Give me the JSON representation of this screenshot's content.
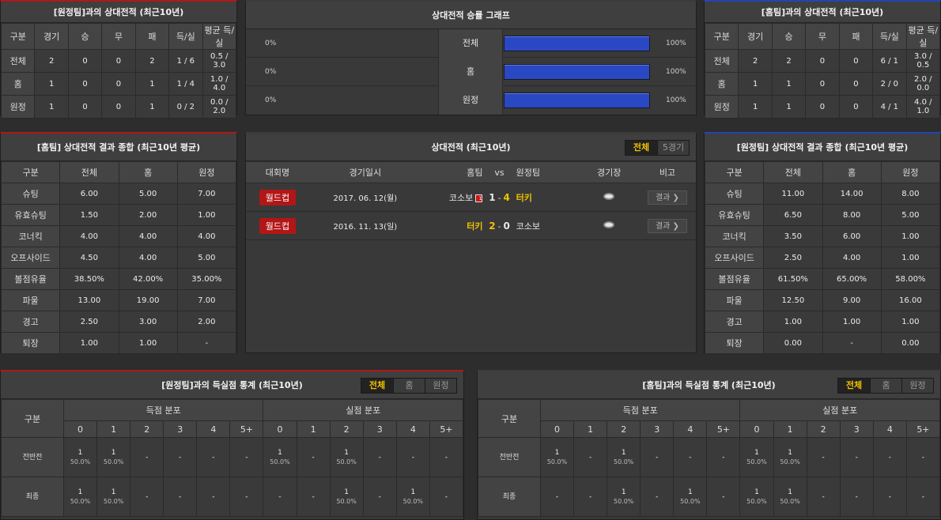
{
  "away_h2h": {
    "title": "[원정팀]과의 상대전적 (최근10년)",
    "headers": [
      "구분",
      "경기",
      "승",
      "무",
      "패",
      "득/실",
      "평균 득/실"
    ],
    "rows": [
      [
        "전체",
        "2",
        "0",
        "0",
        "2",
        "1 / 6",
        "0.5 / 3.0"
      ],
      [
        "홈",
        "1",
        "0",
        "0",
        "1",
        "1 / 4",
        "1.0 / 4.0"
      ],
      [
        "원정",
        "1",
        "0",
        "0",
        "1",
        "0 / 2",
        "0.0 / 2.0"
      ]
    ]
  },
  "graph": {
    "title": "상대전적 승률 그래프",
    "rows": [
      {
        "left": "0%",
        "label": "전체",
        "right": "100%",
        "value": 100
      },
      {
        "left": "0%",
        "label": "홈",
        "right": "100%",
        "value": 100
      },
      {
        "left": "0%",
        "label": "원정",
        "right": "100%",
        "value": 100
      }
    ]
  },
  "home_h2h": {
    "title": "[홈팀]과의 상대전적 (최근10년)",
    "headers": [
      "구분",
      "경기",
      "승",
      "무",
      "패",
      "득/실",
      "평균 득/실"
    ],
    "rows": [
      [
        "전체",
        "2",
        "2",
        "0",
        "0",
        "6 / 1",
        "3.0 / 0.5"
      ],
      [
        "홈",
        "1",
        "1",
        "0",
        "0",
        "2 / 0",
        "2.0 / 0.0"
      ],
      [
        "원정",
        "1",
        "1",
        "0",
        "0",
        "4 / 1",
        "4.0 / 1.0"
      ]
    ]
  },
  "home_summary": {
    "title": "[홈팀] 상대전적 결과 종합 (최근10년 평균)",
    "headers": [
      "구분",
      "전체",
      "홈",
      "원정"
    ],
    "rows": [
      [
        "슈팅",
        "6.00",
        "5.00",
        "7.00"
      ],
      [
        "유효슈팅",
        "1.50",
        "2.00",
        "1.00"
      ],
      [
        "코너킥",
        "4.00",
        "4.00",
        "4.00"
      ],
      [
        "오프사이드",
        "4.50",
        "4.00",
        "5.00"
      ],
      [
        "볼점유율",
        "38.50%",
        "42.00%",
        "35.00%"
      ],
      [
        "파울",
        "13.00",
        "19.00",
        "7.00"
      ],
      [
        "경고",
        "2.50",
        "3.00",
        "2.00"
      ],
      [
        "퇴장",
        "1.00",
        "1.00",
        "-"
      ]
    ]
  },
  "matches": {
    "title": "상대전적 (최근10년)",
    "toggle": [
      "전체",
      "5경기"
    ],
    "headers": {
      "league": "대회명",
      "date": "경기일시",
      "home": "홈팀",
      "vs": "vs",
      "away": "원정팀",
      "stadium": "경기장",
      "note": "비고"
    },
    "rows": [
      {
        "league": "월드컵",
        "date": "2017. 06. 12(월)",
        "home": "코소보",
        "card": "1",
        "home_score": "1",
        "dash": "-",
        "away_score": "4",
        "away": "터키",
        "result": "결과 ❯"
      },
      {
        "league": "월드컵",
        "date": "2016. 11. 13(일)",
        "home": "터키",
        "card": "",
        "home_score": "2",
        "dash": "-",
        "away_score": "0",
        "away": "코소보",
        "result": "결과 ❯"
      }
    ]
  },
  "away_summary": {
    "title": "[원정팀] 상대전적 결과 종합 (최근10년 평균)",
    "headers": [
      "구분",
      "전체",
      "홈",
      "원정"
    ],
    "rows": [
      [
        "슈팅",
        "11.00",
        "14.00",
        "8.00"
      ],
      [
        "유효슈팅",
        "6.50",
        "8.00",
        "5.00"
      ],
      [
        "코너킥",
        "3.50",
        "6.00",
        "1.00"
      ],
      [
        "오프사이드",
        "2.50",
        "4.00",
        "1.00"
      ],
      [
        "볼점유율",
        "61.50%",
        "65.00%",
        "58.00%"
      ],
      [
        "파울",
        "12.50",
        "9.00",
        "16.00"
      ],
      [
        "경고",
        "1.00",
        "1.00",
        "1.00"
      ],
      [
        "퇴장",
        "0.00",
        "-",
        "0.00"
      ]
    ]
  },
  "left_dist": {
    "title": "[원정팀]과의 득실점 통계 (최근10년)",
    "toggle": [
      "전체",
      "홈",
      "원정"
    ],
    "col_label": "구분",
    "score_label": "득점 분포",
    "concede_label": "실점 분포",
    "buckets": [
      "0",
      "1",
      "2",
      "3",
      "4",
      "5+"
    ],
    "rows": [
      {
        "label": "전반전",
        "cells": [
          [
            "1",
            "50.0%"
          ],
          [
            "1",
            "50.0%"
          ],
          [
            "-",
            ""
          ],
          [
            "-",
            ""
          ],
          [
            "-",
            ""
          ],
          [
            "-",
            ""
          ],
          [
            "1",
            "50.0%"
          ],
          [
            "-",
            ""
          ],
          [
            "1",
            "50.0%"
          ],
          [
            "-",
            ""
          ],
          [
            "-",
            ""
          ],
          [
            "-",
            ""
          ]
        ]
      },
      {
        "label": "최종",
        "cells": [
          [
            "1",
            "50.0%"
          ],
          [
            "1",
            "50.0%"
          ],
          [
            "-",
            ""
          ],
          [
            "-",
            ""
          ],
          [
            "-",
            ""
          ],
          [
            "-",
            ""
          ],
          [
            "-",
            ""
          ],
          [
            "-",
            ""
          ],
          [
            "1",
            "50.0%"
          ],
          [
            "-",
            ""
          ],
          [
            "1",
            "50.0%"
          ],
          [
            "-",
            ""
          ]
        ]
      }
    ]
  },
  "right_dist": {
    "title": "[홈팀]과의 득실점 통계 (최근10년)",
    "toggle": [
      "전체",
      "홈",
      "원정"
    ],
    "col_label": "구분",
    "score_label": "득점 분포",
    "concede_label": "실점 분포",
    "buckets": [
      "0",
      "1",
      "2",
      "3",
      "4",
      "5+"
    ],
    "rows": [
      {
        "label": "전반전",
        "cells": [
          [
            "1",
            "50.0%"
          ],
          [
            "-",
            ""
          ],
          [
            "1",
            "50.0%"
          ],
          [
            "-",
            ""
          ],
          [
            "-",
            ""
          ],
          [
            "-",
            ""
          ],
          [
            "1",
            "50.0%"
          ],
          [
            "1",
            "50.0%"
          ],
          [
            "-",
            ""
          ],
          [
            "-",
            ""
          ],
          [
            "-",
            ""
          ],
          [
            "-",
            ""
          ]
        ]
      },
      {
        "label": "최종",
        "cells": [
          [
            "-",
            ""
          ],
          [
            "-",
            ""
          ],
          [
            "1",
            "50.0%"
          ],
          [
            "-",
            ""
          ],
          [
            "1",
            "50.0%"
          ],
          [
            "-",
            ""
          ],
          [
            "1",
            "50.0%"
          ],
          [
            "1",
            "50.0%"
          ],
          [
            "-",
            ""
          ],
          [
            "-",
            ""
          ],
          [
            "-",
            ""
          ],
          [
            "-",
            ""
          ]
        ]
      }
    ]
  },
  "colors": {
    "accent": "#f2c200",
    "home_border": "#b01818",
    "away_border": "#2344b4",
    "bar": "#2a48c4",
    "league_badge": "#b31616"
  }
}
